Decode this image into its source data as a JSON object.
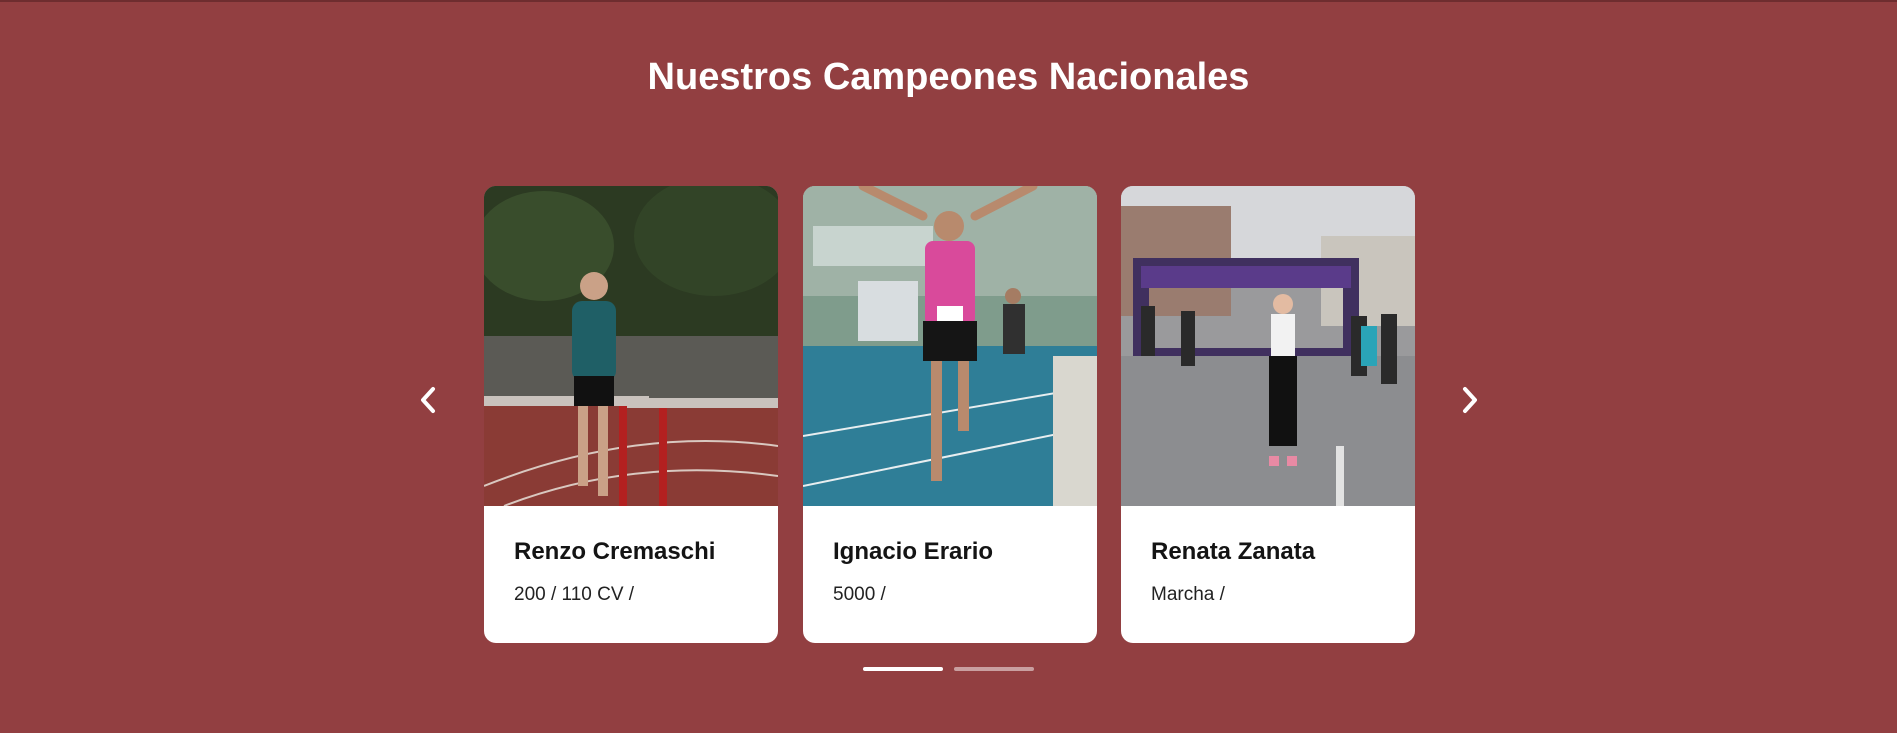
{
  "section": {
    "title": "Nuestros Campeones Nacionales"
  },
  "colors": {
    "background": "#923f41",
    "card": "#ffffff",
    "text": "#141414"
  },
  "navigation": {
    "prev_icon": "chevron-left-icon",
    "next_icon": "chevron-right-icon"
  },
  "cards": [
    {
      "name": "Renzo Cremaschi",
      "events": "200 / 110 CV /"
    },
    {
      "name": "Ignacio Erario",
      "events": "5000 /"
    },
    {
      "name": "Renata Zanata",
      "events": "Marcha /"
    }
  ],
  "pagination": {
    "pages": 2,
    "active": 1
  }
}
